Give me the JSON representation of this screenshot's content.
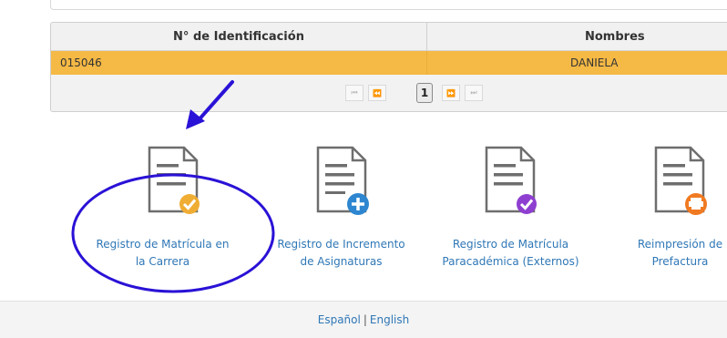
{
  "grid": {
    "headers": [
      "N° de Identificación",
      "Nombres"
    ],
    "row": {
      "id": "015046",
      "name": "DANIELA"
    },
    "pager": {
      "first": "⏮",
      "prev": "⏪",
      "current": "1",
      "next": "⏩",
      "last": "⏭"
    }
  },
  "tiles": [
    {
      "line1": "Registro de Matrícula en",
      "line2": "la Carrera",
      "badge": "check-icon",
      "badge_color": "#f0ad33"
    },
    {
      "line1": "Registro de Incremento",
      "line2": "de Asignaturas",
      "badge": "plus-icon",
      "badge_color": "#2e86d0"
    },
    {
      "line1": "Registro de Matrícula",
      "line2": "Paracadémica (Externos)",
      "badge": "check-icon",
      "badge_color": "#8e3fd0"
    },
    {
      "line1": "Reimpresión de",
      "line2": "Prefactura",
      "badge": "printer-icon",
      "badge_color": "#f07a22"
    }
  ],
  "footer": {
    "lang_es": "Español",
    "separator": "|",
    "lang_en": "English"
  },
  "annotation": {
    "color": "#2a12d6",
    "arrow": "arrow-icon",
    "circle": "highlight-circle"
  }
}
